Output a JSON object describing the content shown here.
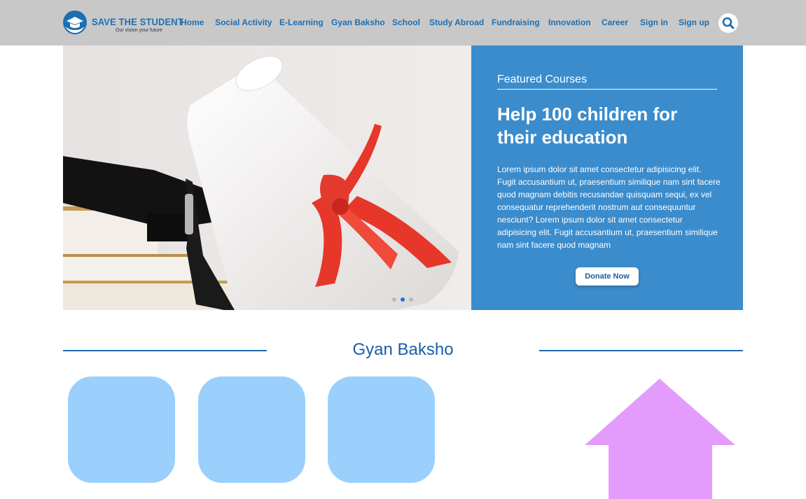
{
  "brand": {
    "name": "SAVE THE STUDENT",
    "tagline": "Our vision your future",
    "logo_icon": "graduation-cap-hands-icon",
    "color": "#1b6fb3"
  },
  "nav": {
    "items": [
      {
        "label": "Home"
      },
      {
        "label": "Social Activity"
      },
      {
        "label": "E-Learning"
      },
      {
        "label": "Gyan Baksho"
      },
      {
        "label": "School"
      },
      {
        "label": "Study Abroad"
      },
      {
        "label": "Fundraising"
      },
      {
        "label": "Innovation"
      },
      {
        "label": "Career"
      },
      {
        "label": "Sign in"
      },
      {
        "label": "Sign up"
      }
    ],
    "search_icon": "search-icon"
  },
  "hero": {
    "image": "graduation-diploma-with-red-ribbon-cap-and-books",
    "slides": {
      "count": 3,
      "active": 2
    }
  },
  "featured": {
    "label": "Featured Courses",
    "title": "Help 100 children for their education",
    "body": "Lorem ipsum dolor sit amet consectetur adipisicing elit. Fugit accusantium ut, praesentium similique nam sint facere quod magnam debitis recusandae quisquam sequi, ex vel consequatur reprehenderit nostrum aut consequuntur nesciunt? Lorem ipsum dolor sit amet consectetur adipisicing elit. Fugit accusantium ut, praesentium similique nam sint facere quod magnam",
    "button": "Donate Now",
    "bg_color": "#3a8ccc"
  },
  "section": {
    "title": "Gyan Baksho",
    "cards": 3,
    "card_color": "#9bcffc"
  },
  "scroll_top": {
    "icon": "up-arrow-icon",
    "color": "#e39cfc"
  }
}
